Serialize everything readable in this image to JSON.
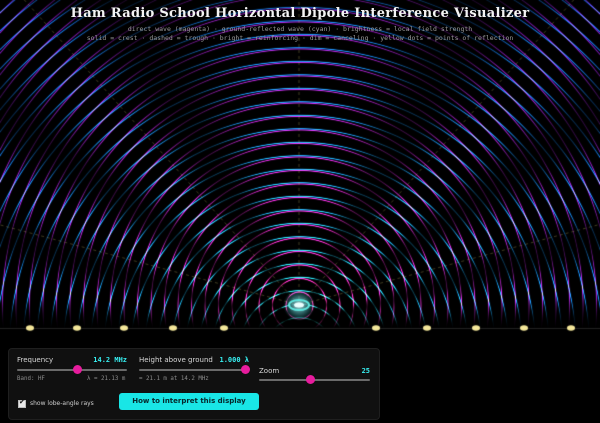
{
  "header": {
    "title": "Ham Radio School Horizontal Dipole Interference Visualizer",
    "legend_line1": "direct wave (magenta)  ·  ground-reflected wave (cyan)  ·  brightness = local field strength",
    "legend_line2": "solid = crest · dashed = trough · bright = reinforcing · dim = canceling · yellow dots = points of reflection"
  },
  "colors": {
    "direct": "#e0309d",
    "reflected": "#26e8d8",
    "reflection_dot": "#f4e79a",
    "accent": "#37f0f2",
    "thumb": "#e71c9d",
    "button": "#19e6e6"
  },
  "controls": {
    "frequency": {
      "label": "Frequency",
      "value": "14.2 MHz",
      "band": "Band: HF",
      "wavelength": "λ = 21.13 m",
      "level": 0.55
    },
    "height": {
      "label": "Height above ground",
      "value": "1.000 λ",
      "hint": "= 21.1 m at 14.2 MHz",
      "level": 1.0
    },
    "zoom": {
      "label": "Zoom",
      "value": "25",
      "level": 0.46
    },
    "rays": {
      "label": "show lobe-angle rays",
      "checked": true,
      "check_glyph": "✔"
    },
    "interpret_button": "How to interpret this display"
  }
}
